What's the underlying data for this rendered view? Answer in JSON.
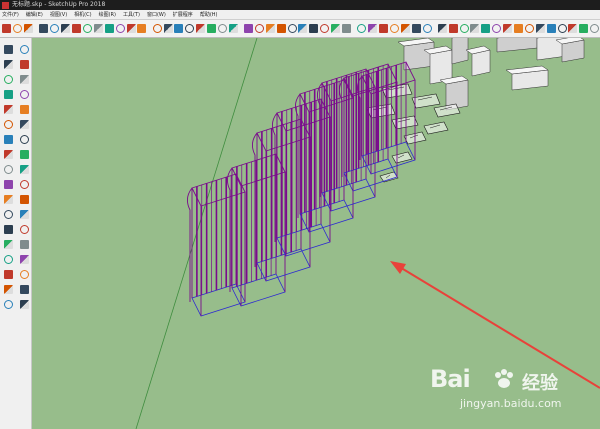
{
  "window": {
    "title": "无标题.skp - SketchUp Pro 2018"
  },
  "menu": {
    "items": [
      {
        "label": "文件(F)"
      },
      {
        "label": "编辑(E)"
      },
      {
        "label": "视图(V)"
      },
      {
        "label": "相机(C)"
      },
      {
        "label": "绘图(R)"
      },
      {
        "label": "工具(T)"
      },
      {
        "label": "窗口(W)"
      },
      {
        "label": "扩展程序"
      },
      {
        "label": "帮助(H)"
      }
    ]
  },
  "colors": {
    "viewport_bg": "#97bd8b",
    "wireframe": "#7a0a8c",
    "wireframe_edge": "#2d2ad0",
    "arrow": "#e8423a",
    "axis_green": "#2e7d32"
  },
  "toolbar": {
    "icons": [
      "select-icon",
      "eraser-icon",
      "paint-icon",
      "pencil-icon",
      "line-icon",
      "arc-icon",
      "rectangle-icon",
      "push-pull-icon",
      "move-icon",
      "rotate-icon",
      "scale-icon",
      "offset-icon",
      "tape-icon",
      "text-icon",
      "dimension-icon",
      "protractor-icon",
      "axes-icon",
      "orbit-icon",
      "pan-icon",
      "zoom-icon",
      "zoom-extents-icon",
      "warehouse-icon",
      "share-icon",
      "extension-icon",
      "iso-view-icon",
      "top-view-icon",
      "front-view-icon",
      "right-view-icon",
      "back-view-icon",
      "left-view-icon",
      "home-icon",
      "xray-icon",
      "wireframe-icon",
      "hidden-line-icon",
      "shaded-icon",
      "textured-icon",
      "monochrome-icon",
      "section-plane-icon",
      "section-display-icon",
      "section-cut-icon",
      "style-icon",
      "layer-icon",
      "shadow-icon",
      "fog-icon",
      "match-photo-icon",
      "scene-icon",
      "outliner-icon",
      "component-icon",
      "material-icon",
      "entity-info-icon",
      "soften-icon",
      "instructor-icon",
      "solid-tools-icon"
    ]
  },
  "side_toolbar": {
    "icons": [
      "select-icon",
      "make-component-icon",
      "paint-bucket-icon",
      "eraser-icon",
      "line-icon",
      "freehand-icon",
      "rectangle-icon",
      "rotated-rectangle-icon",
      "circle-icon",
      "polygon-icon",
      "arc-icon",
      "two-point-arc-icon",
      "three-point-arc-icon",
      "pie-icon",
      "move-icon",
      "push-pull-icon",
      "rotate-icon",
      "follow-me-icon",
      "scale-icon",
      "offset-icon",
      "tape-measure-icon",
      "dimension-icon",
      "protractor-icon",
      "text-icon",
      "axes-icon",
      "3d-text-icon",
      "orbit-icon",
      "pan-icon",
      "zoom-icon",
      "zoom-window-icon",
      "zoom-extents-icon",
      "previous-view-icon",
      "position-camera-icon",
      "look-around-icon",
      "walk-icon",
      "section-plane-icon"
    ]
  },
  "watermark": {
    "brand": "Bai",
    "brand_cn": "经验",
    "url": "jingyan.baidu.com"
  }
}
